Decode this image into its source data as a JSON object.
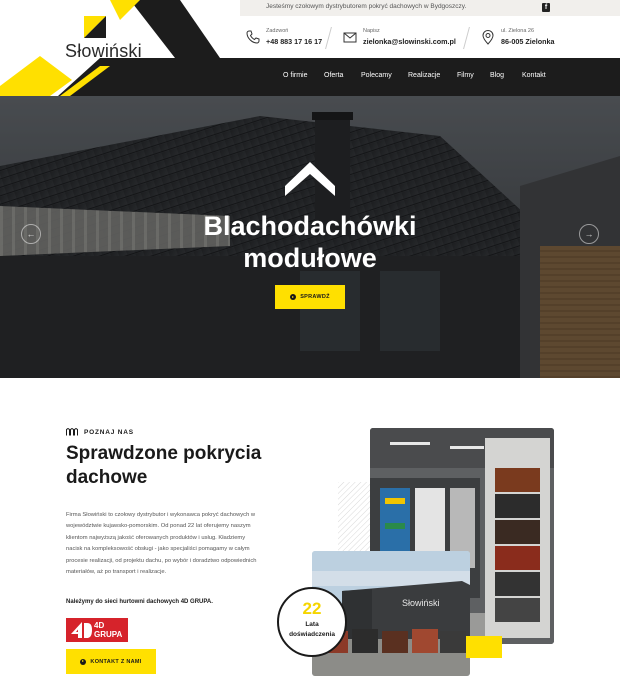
{
  "brand": {
    "logo_text": "Słowiński",
    "accent": "#ffe000",
    "dark": "#1c1c1c",
    "red": "#d6232b"
  },
  "topbar": {
    "tagline": "Jesteśmy czołowym dystrybutorem pokryć dachowych w Bydgoszczy.",
    "social_icon": "facebook-icon"
  },
  "contacts": [
    {
      "icon": "phone-icon",
      "label": "Zadzwoń",
      "value": "+48 883 17 16 17"
    },
    {
      "icon": "mail-icon",
      "label": "Napisz",
      "value": "zielonka@slowinski.com.pl"
    },
    {
      "icon": "location-icon",
      "label": "ul. Zielona 26",
      "value": "86-005 Zielonka"
    }
  ],
  "nav": [
    "O firmie",
    "Oferta",
    "Polecamy",
    "Realizacje",
    "Filmy",
    "Blog",
    "Kontakt"
  ],
  "hero": {
    "title_line1": "Blachodachówki",
    "title_line2": "modułowe",
    "button": "SPRAWDŹ",
    "prev_icon": "arrow-left-icon",
    "next_icon": "arrow-right-icon"
  },
  "about": {
    "eyebrow": "POZNAJ NAS",
    "title_line1": "Sprawdzone pokrycia",
    "title_line2": "dachowe",
    "body": [
      "Firma Słowiński to czołowy dystrybutor i wykonawca pokryć dachowych w",
      "województwie kujawsko-pomorskim. Od ponad 22 lat oferujemy naszym",
      "klientom najwyższą jakość oferowanych produktów i usług. Kładziemy",
      "nacisk na kompleksowość obsługi - jako specjaliści pomagamy w całym",
      "procesie realizacji, od projektu dachu, po wybór i doradztwo odpowiednich",
      "materiałów, aż po transport i realizacje."
    ],
    "network": "Należymy do sieci hurtowni dachowych 4D GRUPA.",
    "partner_logo_line1": "4D",
    "partner_logo_line2": "GRUPA",
    "button": "KONTAKT Z NAMI",
    "badge_number": "22",
    "badge_label_line1": "Lata",
    "badge_label_line2": "doświadczenia",
    "building_sign": "Słowiński"
  }
}
